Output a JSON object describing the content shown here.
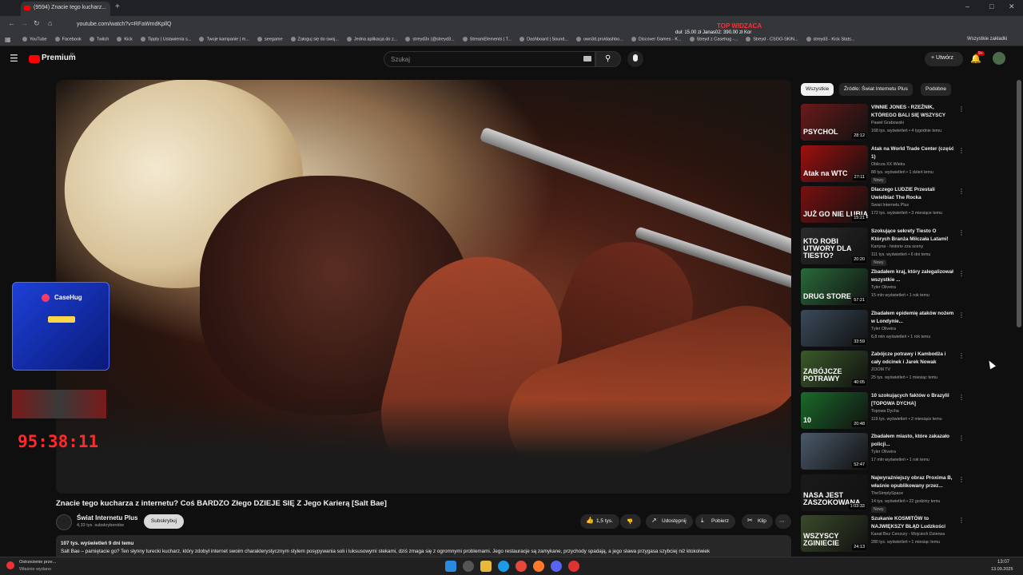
{
  "browser": {
    "tab_title": "(9594) Znacie tego kucharz...",
    "url": "youtube.com/watch?v=RFaWmdKpllQ",
    "promo_title": "TOP WIDZACA",
    "promo_line": "duł: 15.00 zł   Janas02: 390.00 zł   Kor",
    "bookmarks": [
      "YouTube",
      "Facebook",
      "Twitch",
      "Kick",
      "Tipply | Ustawienia s...",
      "Twoje kampanie | m...",
      "seegame",
      "Zaloguj się do swoj...",
      "Jedna aplikacja do z...",
      "streyd3x (@streyd3...",
      "StreamElements | T...",
      "Dashboard | Sound...",
      "own3d.pro/dashbo...",
      "Discover Games - K...",
      "Streyd z Casehug -...",
      "Streyd - CSGO-SKIN...",
      "streyd3 - Kick Stats..."
    ],
    "bookmarks_all": "Wszystkie zakładki"
  },
  "yt": {
    "logo": "Premium",
    "logo_sup": "PL",
    "search_placeholder": "Szukaj",
    "create": "Utwórz",
    "notif_count": "9+"
  },
  "overlay": {
    "case_brand": "CaseHug",
    "timer": "95:38:11"
  },
  "video": {
    "title": "Znacie tego kucharza z internetu? Coś BARDZO Złego DZIEJE SIĘ Z Jego Karierą [Salt Bae]",
    "channel": "Świat Internetu Plus",
    "subs": "4,33 tys. subskrybentów",
    "subscribe": "Subskrybuj",
    "likes": "1,5 tys.",
    "share": "Udostępnij",
    "download": "Pobierz",
    "clip": "Klip",
    "views_date": "107 tys. wyświetleń  9 dni temu",
    "description": "Salt Bae – pamiętacie go? Ten słynny turecki kucharz, który zdobył internet swoim charakterystycznym stylem posypywania soli i luksusowymi stekami, dziś zmaga się z ogromnymi problemami. Jego restauracje są zamykane, przychody spadają, a jego sława przygasa szybciej niż ktokolwiek"
  },
  "chips": [
    "Wszystkie",
    "Źródło: Świat Internetu Plus",
    "Podobne"
  ],
  "recommendations": [
    {
      "title": "VINNIE JONES - RZEŹNIK, KTÓREGO BALI SIĘ WSZYSCY",
      "channel": "Paweł Grabowski",
      "stats": "168 tys. wyświetleń • 4 tygodnie temu",
      "duration": "28:12",
      "new": "",
      "color": "#6a1a1a",
      "label": "PSYCHOL"
    },
    {
      "title": "Atak na World Trade Center (część 1)",
      "channel": "Oblicza XX Wieku",
      "stats": "88 tys. wyświetleń • 1 dzień temu",
      "duration": "27:11",
      "new": "Nowy",
      "color": "#a01010",
      "label": "Atak na WTC"
    },
    {
      "title": "Dlaczego LUDZIE Przestali Uwielbiać The Rocka",
      "channel": "Świat Internetu Plus",
      "stats": "172 tys. wyświetleń • 3 miesiące temu",
      "duration": "15:21",
      "new": "",
      "color": "#7a1010",
      "label": "JUŻ GO NIE LUBIĄ"
    },
    {
      "title": "Szokujące sekrety Tiesto O Których Branża Milczała Latami!",
      "channel": "Kartyna - historie zza sceny",
      "stats": "111 tys. wyświetleń • 6 dni temu",
      "duration": "20:20",
      "new": "Nowy",
      "color": "#2a2a2a",
      "label": "KTO ROBI UTWORY DLA TIESTO?"
    },
    {
      "title": "Zbadałem kraj, który zalegalizował wszystkie ...",
      "channel": "Tyler Oliveira",
      "stats": "15 mln wyświetleń • 1 rok temu",
      "duration": "57:21",
      "new": "",
      "color": "#2a6a3a",
      "label": "DRUG STORE"
    },
    {
      "title": "Zbadałem epidemię ataków nożem w Londynie...",
      "channel": "Tyler Oliveira",
      "stats": "6,8 mln wyświetleń • 1 rok temu",
      "duration": "33:59",
      "new": "",
      "color": "#3a4a5a",
      "label": ""
    },
    {
      "title": "Zabójcze potrawy i Kambodża i cały odcinek i Jarek Nowak",
      "channel": "ZOOM TV",
      "stats": "25 tys. wyświetleń • 1 miesiąc temu",
      "duration": "40:05",
      "new": "",
      "color": "#3a5a2a",
      "label": "ZABÓJCZE POTRAWY"
    },
    {
      "title": "10 szokujących faktów o Brazylii [TOPOWA DYCHA]",
      "channel": "Topowa Dycha",
      "stats": "119 tys. wyświetleń • 2 miesiące temu",
      "duration": "20:48",
      "new": "",
      "color": "#1a6a2a",
      "label": "10"
    },
    {
      "title": "Zbadałem miasto, które zakazało policji...",
      "channel": "Tyler Oliveira",
      "stats": "17 mln wyświetleń • 1 rok temu",
      "duration": "52:47",
      "new": "",
      "color": "#4a5a6a",
      "label": ""
    },
    {
      "title": "Najwyraźniejszy obraz Proxima B, właśnie opublikowany przez...",
      "channel": "TheSimplySpace",
      "stats": "14 tys. wyświetleń • 22 godziny temu",
      "duration": "1:03:33",
      "new": "Nowy",
      "color": "#1a1a1a",
      "label": "NASA JEST ZASZOKOWANA"
    },
    {
      "title": "Szukanie KOSMITÓW to NAJWIĘKSZY BŁĄD Ludzkości",
      "channel": "Kanał Bez Cenzury - Wojciech Dzierwa",
      "stats": "280 tys. wyświetleń • 1 miesiąc temu",
      "duration": "24:13",
      "new": "",
      "color": "#3a4a2a",
      "label": "WSZYSCY ZGINIECIE"
    }
  ],
  "taskbar": {
    "notice_title": "Ostrzeżenie prze...",
    "notice_sub": "Właśnie wydano",
    "time": "13:07",
    "date": "13.09.2025"
  }
}
